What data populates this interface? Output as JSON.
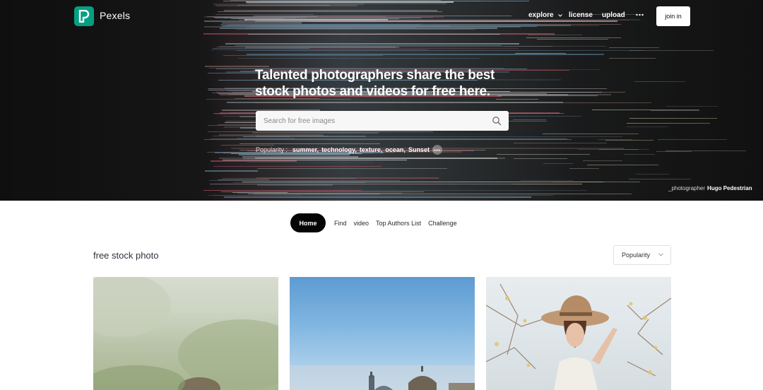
{
  "brand": {
    "name": "Pexels",
    "accent": "#05a081"
  },
  "nav": {
    "items": [
      {
        "label": "explore"
      },
      {
        "label": "license"
      },
      {
        "label": "upload"
      }
    ],
    "more_icon": "ellipsis-icon",
    "join_label": "join in"
  },
  "hero": {
    "headline": "Talented photographers share the best stock photos and videos for free here.",
    "search_placeholder": "Search for free images",
    "popular_label": "Popularity :",
    "popular_tags": [
      "summer,",
      "technology,",
      "texture,",
      "ocean,",
      "Sunset"
    ],
    "credit_label": "_photographer",
    "credit_name": "Hugo Pedestrian"
  },
  "tabs": {
    "items": [
      {
        "label": "Home",
        "active": true
      },
      {
        "label": "Find"
      },
      {
        "label": "video"
      },
      {
        "label": "Top Authors List"
      },
      {
        "label": "Challenge"
      }
    ]
  },
  "section": {
    "title": "free stock photo",
    "sort_label": "Popularity"
  }
}
